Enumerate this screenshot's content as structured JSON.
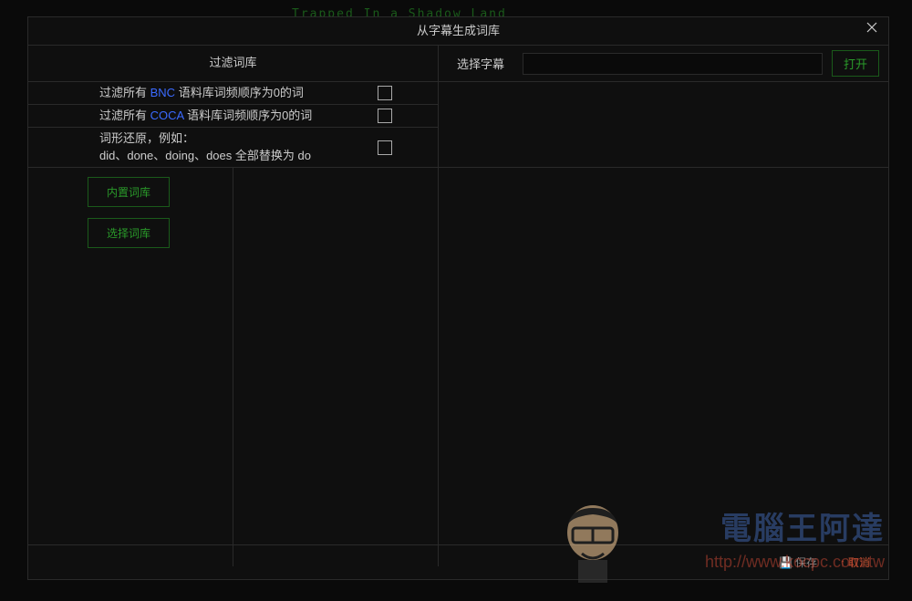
{
  "bg_text": "Trapped In a Shadow Land",
  "dialog": {
    "title": "从字幕生成词库"
  },
  "header": {
    "filter_title": "过滤词库",
    "subtitle_label": "选择字幕",
    "open_btn": "打开"
  },
  "filters": {
    "row1_prefix": "过滤所有 ",
    "row1_blue": "BNC",
    "row1_suffix": " 语料库词频顺序为0的词",
    "row2_prefix": "过滤所有 ",
    "row2_blue": "COCA",
    "row2_suffix": " 语料库词频顺序为0的词",
    "row3_line1": "词形还原，例如：",
    "row3_line2": "did、done、doing、does 全部替换为 do"
  },
  "buttons": {
    "builtin_lib": "内置词库",
    "select_lib": "选择词库"
  },
  "footer": {
    "save": "保存",
    "cancel": "取消"
  },
  "watermark": {
    "cn": "電腦王阿達",
    "url": "http://www.kocpc.com.tw"
  }
}
